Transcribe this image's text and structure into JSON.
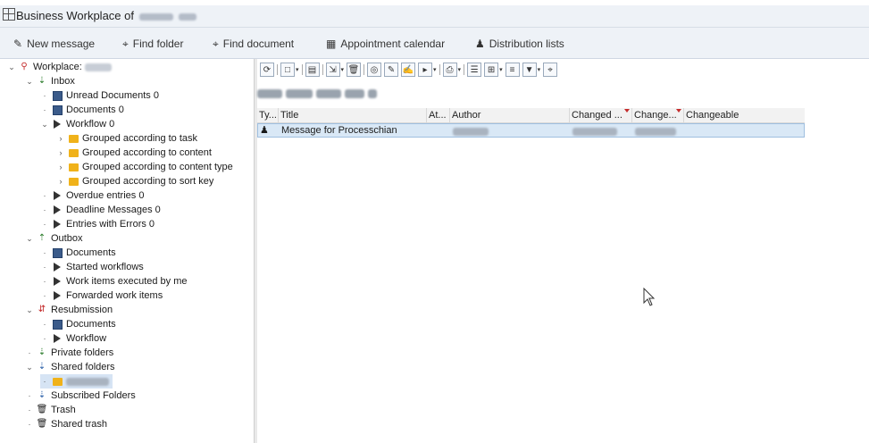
{
  "window": {
    "title": "Business Workplace of"
  },
  "toolbar": {
    "new_message": "New message",
    "find_folder": "Find folder",
    "find_document": "Find document",
    "appointment_calendar": "Appointment calendar",
    "distribution_lists": "Distribution lists"
  },
  "tree": {
    "workplace": "Workplace:",
    "inbox": "Inbox",
    "unread_documents": "Unread Documents 0",
    "documents_0": "Documents 0",
    "workflow_0": "Workflow 0",
    "grouped_task": "Grouped according to task",
    "grouped_content": "Grouped according to content",
    "grouped_content_type": "Grouped according to content type",
    "grouped_sort_key": "Grouped according to sort key",
    "overdue_entries": "Overdue entries 0",
    "deadline_messages": "Deadline Messages 0",
    "entries_errors": "Entries with Errors 0",
    "outbox": "Outbox",
    "outbox_documents": "Documents",
    "started_workflows": "Started workflows",
    "work_items_executed": "Work items executed by me",
    "forwarded_work_items": "Forwarded work items",
    "resubmission": "Resubmission",
    "resub_documents": "Documents",
    "resub_workflow": "Workflow",
    "private_folders": "Private folders",
    "shared_folders": "Shared folders",
    "subscribed_folders": "Subscribed Folders",
    "trash": "Trash",
    "shared_trash": "Shared trash"
  },
  "grid": {
    "columns": [
      "Ty...",
      "Title",
      "At...",
      "Author",
      "Changed ...",
      "Change...",
      "Changeable"
    ],
    "rows": [
      {
        "type_icon": "message-icon",
        "title": "Message for Processchian"
      }
    ]
  },
  "colors": {
    "folder": "#f0b21a",
    "selection": "#d9e8f6",
    "sort_indicator": "#c42b2b"
  }
}
